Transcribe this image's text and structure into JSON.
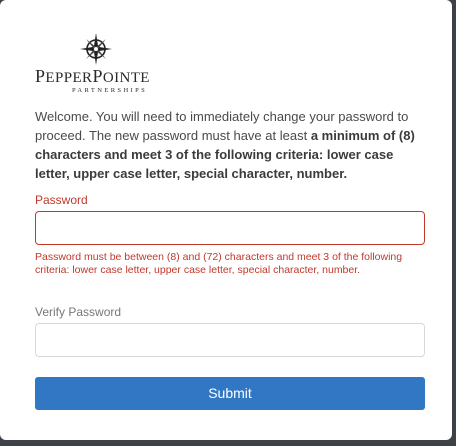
{
  "logo": {
    "wordmark_p1_cap": "P",
    "wordmark_p1_rest": "EPPER",
    "wordmark_p2_cap": "P",
    "wordmark_p2_rest": "OINTE",
    "subtitle": "PARTNERSHIPS"
  },
  "intro": {
    "text_plain": "Welcome. You will need to immediately change your password to proceed. The new password must have at least ",
    "text_bold": "a minimum of (8) characters and meet 3 of the following criteria: lower case letter, upper case letter, special character, number."
  },
  "password": {
    "label": "Password",
    "value": "",
    "error": "Password must be between (8) and (72) characters and meet 3 of the following criteria: lower case letter, upper case letter, special character, number."
  },
  "verify_password": {
    "label": "Verify Password",
    "value": ""
  },
  "submit_label": "Submit",
  "colors": {
    "accent": "#3177c4",
    "error": "#c0392b",
    "backdrop": "#3d4148"
  },
  "icons": {
    "logo_mark": "compass-rose-icon"
  }
}
